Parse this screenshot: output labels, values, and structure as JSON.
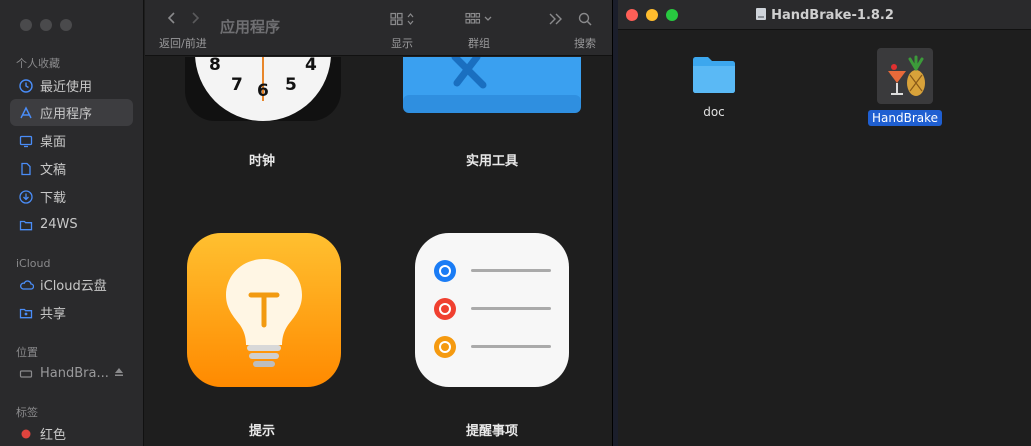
{
  "finder": {
    "sidebar": {
      "favorites_header": "个人收藏",
      "items": [
        {
          "label": "最近使用",
          "icon": "clock-icon"
        },
        {
          "label": "应用程序",
          "icon": "applications-icon"
        },
        {
          "label": "桌面",
          "icon": "desktop-icon"
        },
        {
          "label": "文稿",
          "icon": "document-icon"
        },
        {
          "label": "下载",
          "icon": "download-icon"
        },
        {
          "label": "24WS",
          "icon": "folder-icon"
        }
      ],
      "icloud_header": "iCloud",
      "icloud_items": [
        {
          "label": "iCloud云盘",
          "icon": "cloud-icon"
        },
        {
          "label": "共享",
          "icon": "shared-folder-icon"
        }
      ],
      "locations_header": "位置",
      "location_items": [
        {
          "label": "HandBra...",
          "icon": "disk-icon"
        }
      ],
      "tags_header": "标签",
      "tag_items": [
        {
          "label": "红色",
          "color": "#e0443e"
        }
      ]
    },
    "toolbar": {
      "title": "应用程序",
      "back_forward_label": "返回/前进",
      "view_label": "显示",
      "group_label": "群组",
      "search_label": "搜索"
    },
    "apps": [
      {
        "label": "时钟",
        "icon": "clock-app-icon"
      },
      {
        "label": "实用工具",
        "icon": "utilities-folder-icon"
      },
      {
        "label": "提示",
        "icon": "tips-app-icon"
      },
      {
        "label": "提醒事项",
        "icon": "reminders-app-icon"
      }
    ],
    "clock_numbers": [
      "8",
      "4",
      "7",
      "6",
      "5"
    ]
  },
  "dmg_window": {
    "title": "HandBrake-1.8.2",
    "files": [
      {
        "label": "doc",
        "icon": "folder-icon",
        "selected": false
      },
      {
        "label": "HandBrake",
        "icon": "handbrake-app-icon",
        "selected": true
      }
    ]
  },
  "colors": {
    "accent": "#1f5fd1",
    "close": "#ff5f57",
    "minimize": "#febc2e",
    "zoom": "#28c840"
  }
}
